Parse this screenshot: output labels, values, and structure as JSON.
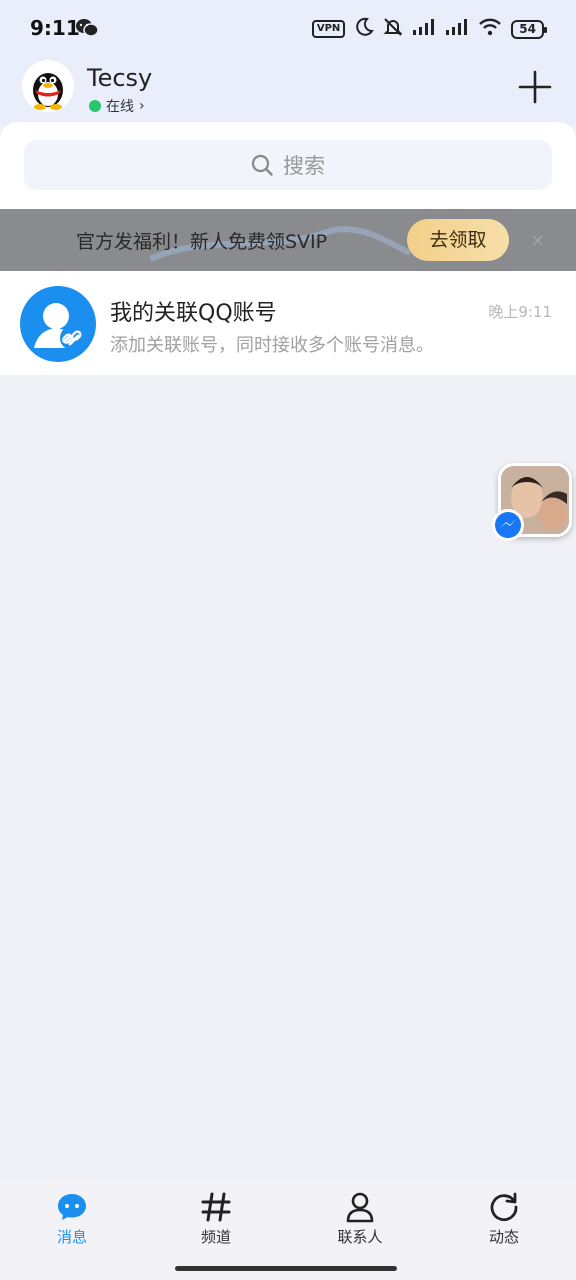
{
  "status_bar": {
    "time": "9:11",
    "vpn": "VPN",
    "battery": "54"
  },
  "header": {
    "username": "Tecsy",
    "status": "在线",
    "status_chevron": "›"
  },
  "search": {
    "placeholder": "搜索"
  },
  "banner": {
    "text": "官方发福利！新人免费领SVIP",
    "button": "去领取",
    "close": "✕"
  },
  "messages": [
    {
      "title": "我的关联QQ账号",
      "subtitle": "添加关联账号，同时接收多个账号消息。",
      "time": "晚上9:11"
    }
  ],
  "nav": [
    {
      "label": "消息",
      "icon": "chat-bubble-icon",
      "active": true
    },
    {
      "label": "频道",
      "icon": "hashtag-icon",
      "active": false
    },
    {
      "label": "联系人",
      "icon": "person-icon",
      "active": false
    },
    {
      "label": "动态",
      "icon": "refresh-star-icon",
      "active": false
    }
  ],
  "colors": {
    "accent": "#1a8ff0",
    "online": "#27c76a",
    "button_gold": "#f3d08a"
  }
}
